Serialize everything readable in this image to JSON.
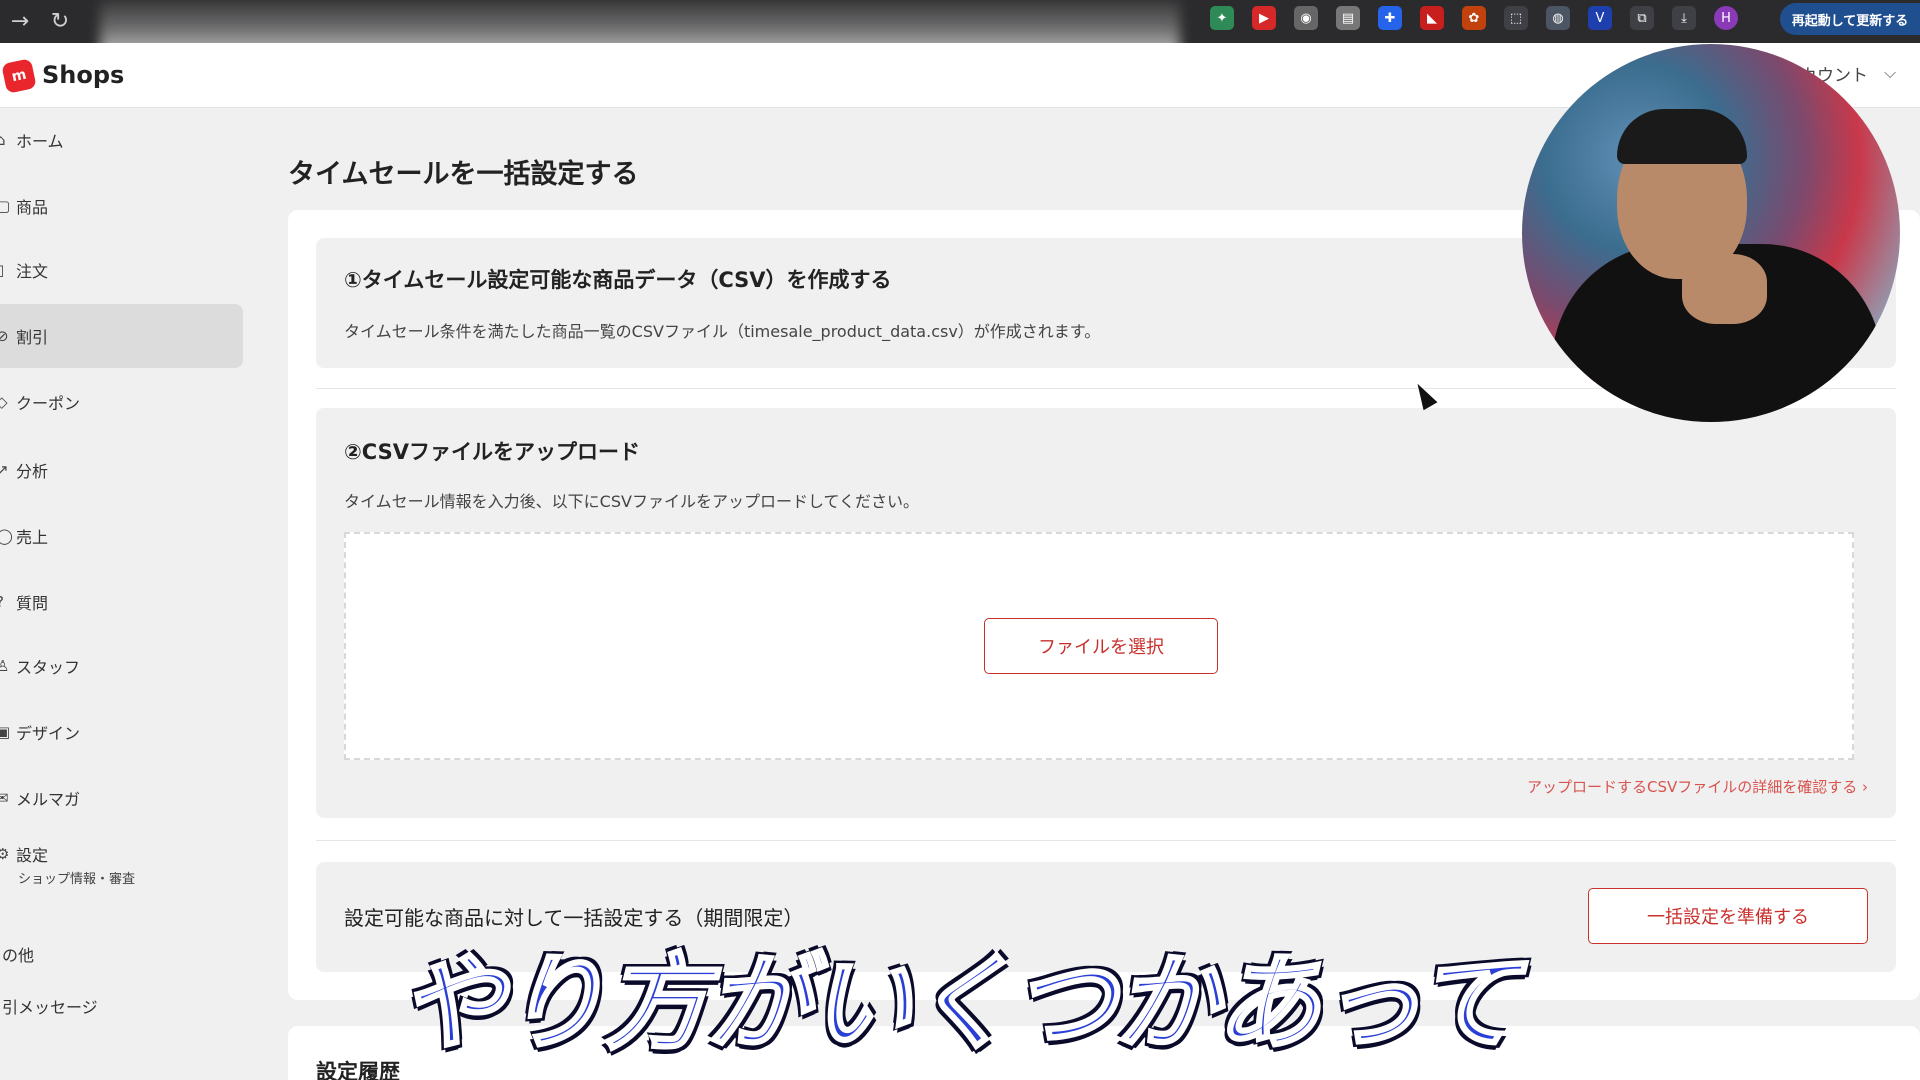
{
  "browser": {
    "update_label": "再起動して更新する",
    "profile_initial": "H"
  },
  "header": {
    "logo_mark": "m",
    "logo_text": "Shops",
    "account_label": "カウント"
  },
  "sidebar": {
    "items": [
      {
        "label": "ホーム",
        "icon": "home-icon"
      },
      {
        "label": "商品",
        "icon": "box-icon"
      },
      {
        "label": "注文",
        "icon": "list-icon"
      },
      {
        "label": "割引",
        "icon": "tag-icon",
        "active": true
      },
      {
        "label": "クーポン",
        "icon": "coupon-icon"
      },
      {
        "label": "分析",
        "icon": "chart-icon"
      },
      {
        "label": "売上",
        "icon": "coin-icon"
      },
      {
        "label": "質問",
        "icon": "question-icon"
      },
      {
        "label": "スタッフ",
        "icon": "person-icon"
      },
      {
        "label": "デザイン",
        "icon": "design-icon"
      },
      {
        "label": "メルマガ",
        "icon": "mail-icon"
      },
      {
        "label": "設定",
        "sub": "ショップ情報・審査",
        "icon": "gear-icon"
      },
      {
        "label": "の他"
      },
      {
        "label": "引メッセージ"
      }
    ]
  },
  "main": {
    "page_title": "タイムセールを一括設定する",
    "section1": {
      "title": "①タイムセール設定可能な商品データ（CSV）を作成する",
      "desc": "タイムセール条件を満たした商品一覧のCSVファイル（timesale_product_data.csv）が作成されます。"
    },
    "section2": {
      "title": "②CSVファイルをアップロード",
      "desc": "タイムセール情報を入力後、以下にCSVファイルをアップロードしてください。",
      "file_button": "ファイルを選択",
      "detail_link": "アップロードするCSVファイルの詳細を確認する ›"
    },
    "section3": {
      "title": "設定可能な商品に対して一括設定する（期間限定）",
      "button": "一括設定を準備する"
    },
    "history_title": "設定履歴"
  },
  "caption": "やり方がいくつかあって",
  "colors": {
    "accent": "#c9302c",
    "caption": "#2a3fd6"
  }
}
